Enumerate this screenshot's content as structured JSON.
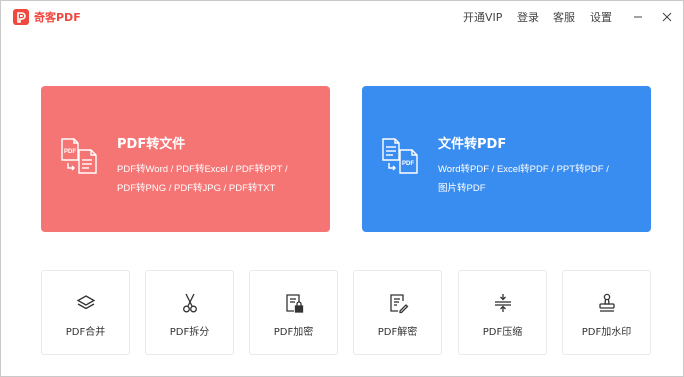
{
  "app": {
    "name": "奇客PDF",
    "brand_color": "#f0483e"
  },
  "header": {
    "menu": [
      "开通VIP",
      "登录",
      "客服",
      "设置"
    ],
    "window_controls": [
      "minimize-icon",
      "close-icon"
    ]
  },
  "cards": [
    {
      "title": "PDF转文件",
      "lines": [
        "PDF转Word / PDF转Excel / PDF转PPT /",
        "PDF转PNG / PDF转JPG / PDF转TXT"
      ],
      "icon": "pdf-to-file-icon",
      "color": "#f57575"
    },
    {
      "title": "文件转PDF",
      "lines": [
        "Word转PDF / Excel转PDF / PPT转PDF /",
        "图片转PDF"
      ],
      "icon": "file-to-pdf-icon",
      "color": "#3a8df0"
    }
  ],
  "tools": [
    {
      "label": "PDF合并",
      "icon": "layers-icon"
    },
    {
      "label": "PDF拆分",
      "icon": "scissors-icon"
    },
    {
      "label": "PDF加密",
      "icon": "lock-document-icon"
    },
    {
      "label": "PDF解密",
      "icon": "edit-document-icon"
    },
    {
      "label": "PDF压缩",
      "icon": "compress-icon"
    },
    {
      "label": "PDF加水印",
      "icon": "stamp-icon"
    }
  ]
}
